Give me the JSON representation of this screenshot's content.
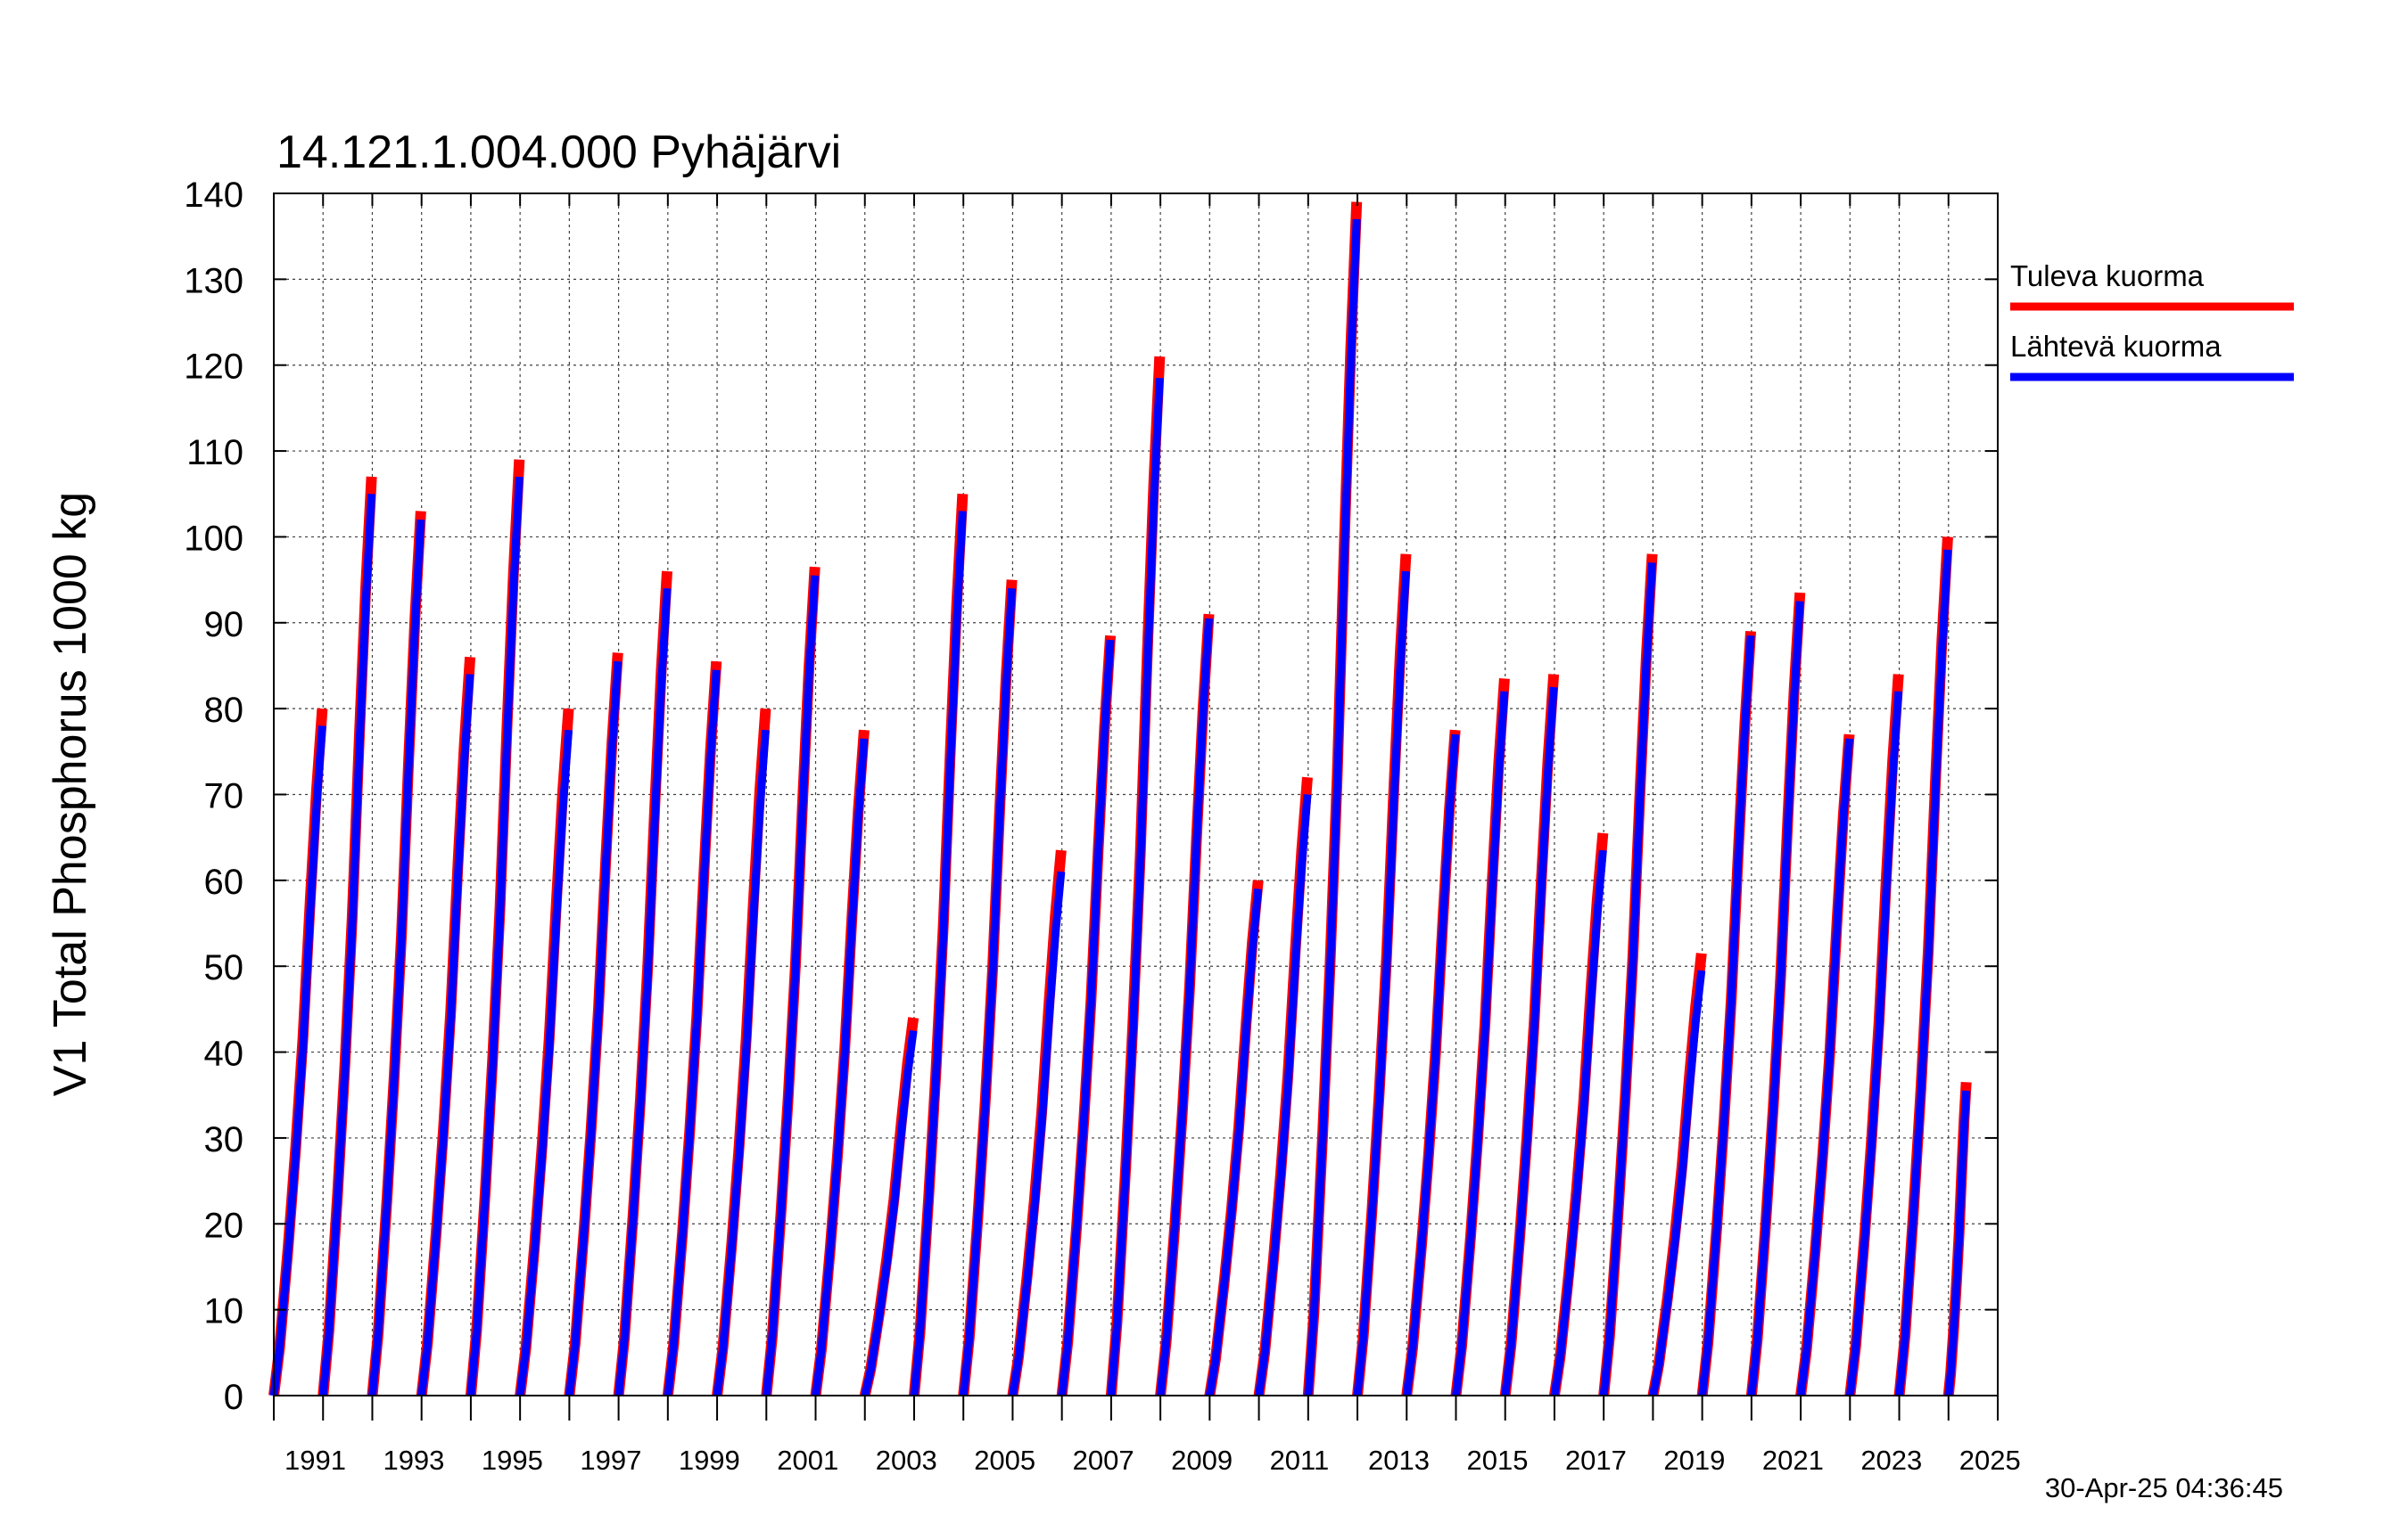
{
  "chart_data": {
    "type": "line",
    "title": "14.121.1.004.000 Pyhäjärvi",
    "ylabel": "V1 Total Phosphorus 1000 kg",
    "xlabel": "",
    "xlim": [
      1990,
      2025
    ],
    "ylim": [
      0,
      140
    ],
    "yticks": [
      0,
      10,
      20,
      30,
      40,
      50,
      60,
      70,
      80,
      90,
      100,
      110,
      120,
      130,
      140
    ],
    "xtick_labels": [
      "1991",
      "1993",
      "1995",
      "1997",
      "1999",
      "2001",
      "2003",
      "2005",
      "2007",
      "2009",
      "2011",
      "2013",
      "2015",
      "2017",
      "2019",
      "2021",
      "2023",
      "2025"
    ],
    "grid": true,
    "legend_position": "right",
    "timestamp": "30-Apr-25 04:36:45",
    "series": [
      {
        "name": "Tuleva kuorma",
        "color": "#ff0000",
        "annual_peaks": [
          [
            1990,
            80
          ],
          [
            1991,
            107
          ],
          [
            1992,
            103
          ],
          [
            1993,
            86
          ],
          [
            1994,
            109
          ],
          [
            1995,
            80
          ],
          [
            1996,
            86.5
          ],
          [
            1997,
            96
          ],
          [
            1998,
            85.5
          ],
          [
            1999,
            80
          ],
          [
            2000,
            96.5
          ],
          [
            2001,
            77.5
          ],
          [
            2002,
            44
          ],
          [
            2003,
            105
          ],
          [
            2004,
            95
          ],
          [
            2005,
            63.5
          ],
          [
            2006,
            88.5
          ],
          [
            2007,
            121
          ],
          [
            2008,
            91
          ],
          [
            2009,
            60
          ],
          [
            2010,
            72
          ],
          [
            2011,
            139
          ],
          [
            2012,
            98
          ],
          [
            2013,
            77.5
          ],
          [
            2014,
            83.5
          ],
          [
            2015,
            84
          ],
          [
            2016,
            65.5
          ],
          [
            2017,
            98
          ],
          [
            2018,
            51.5
          ],
          [
            2019,
            89
          ],
          [
            2020,
            93.5
          ],
          [
            2021,
            77
          ],
          [
            2022,
            84
          ],
          [
            2023,
            100
          ],
          [
            2024,
            36.5
          ]
        ]
      },
      {
        "name": "Lähtevä kuorma",
        "color": "#0000ff",
        "annual_peaks": [
          [
            1990,
            78
          ],
          [
            1991,
            105
          ],
          [
            1992,
            102
          ],
          [
            1993,
            84
          ],
          [
            1994,
            107
          ],
          [
            1995,
            77.5
          ],
          [
            1996,
            85.5
          ],
          [
            1997,
            94
          ],
          [
            1998,
            84.5
          ],
          [
            1999,
            77.5
          ],
          [
            2000,
            95.5
          ],
          [
            2001,
            76.5
          ],
          [
            2002,
            42.5
          ],
          [
            2003,
            103
          ],
          [
            2004,
            94
          ],
          [
            2005,
            61
          ],
          [
            2006,
            88
          ],
          [
            2007,
            118.5
          ],
          [
            2008,
            90.5
          ],
          [
            2009,
            59
          ],
          [
            2010,
            70
          ],
          [
            2011,
            137
          ],
          [
            2012,
            96
          ],
          [
            2013,
            77
          ],
          [
            2014,
            82
          ],
          [
            2015,
            82.5
          ],
          [
            2016,
            63.5
          ],
          [
            2017,
            97
          ],
          [
            2018,
            49.5
          ],
          [
            2019,
            88.5
          ],
          [
            2020,
            92.5
          ],
          [
            2021,
            76.5
          ],
          [
            2022,
            82
          ],
          [
            2023,
            98.5
          ],
          [
            2024,
            35.5
          ]
        ]
      }
    ]
  }
}
